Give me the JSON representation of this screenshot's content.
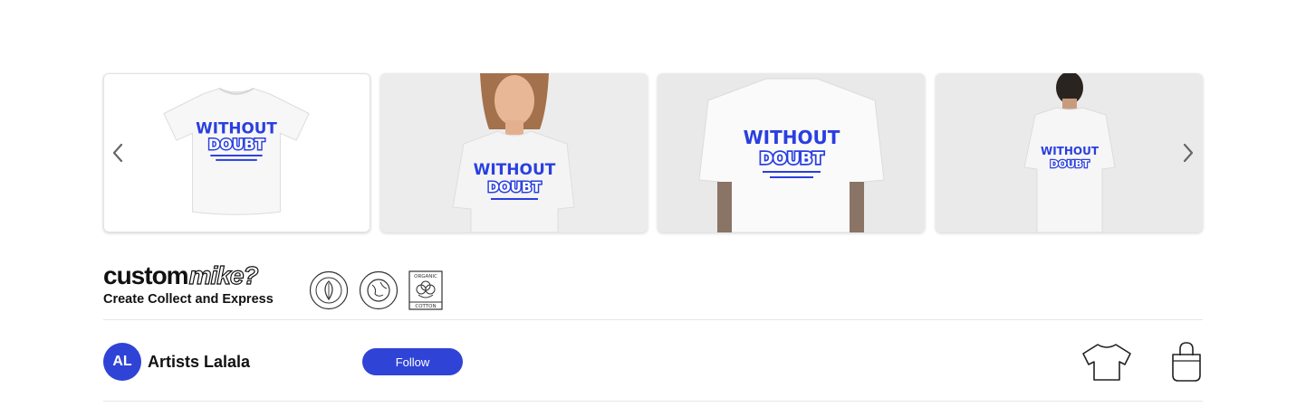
{
  "gallery": {
    "images": [
      {
        "name": "flat-lay-front",
        "alt_print": "WITHOUT DOUBT"
      },
      {
        "name": "model-woman-front",
        "alt_print": "WITHOUT DOUBT"
      },
      {
        "name": "model-man-back-closeup",
        "alt_print": "WITHOUT DOUBT"
      },
      {
        "name": "model-man-back-full",
        "alt_print": "WITHOUT DOUBT"
      }
    ],
    "prev_icon": "chevron-left-icon",
    "next_icon": "chevron-right-icon"
  },
  "brand": {
    "logo_part1": "custom",
    "logo_part2": "mike?",
    "tagline": "Create Collect and Express"
  },
  "badges": [
    {
      "icon": "leaf-seal-icon"
    },
    {
      "icon": "globe-seal-icon"
    },
    {
      "icon": "organic-cotton-icon",
      "top": "ORGANIC",
      "bottom": "COTTON"
    }
  ],
  "artist": {
    "initials": "AL",
    "name": "Artists Lalala",
    "follow_label": "Follow"
  },
  "actions": [
    {
      "icon": "tshirt-icon"
    },
    {
      "icon": "shopping-bag-icon"
    }
  ],
  "colors": {
    "accent": "#2f43d6",
    "print_blue": "#2a3fe0"
  }
}
